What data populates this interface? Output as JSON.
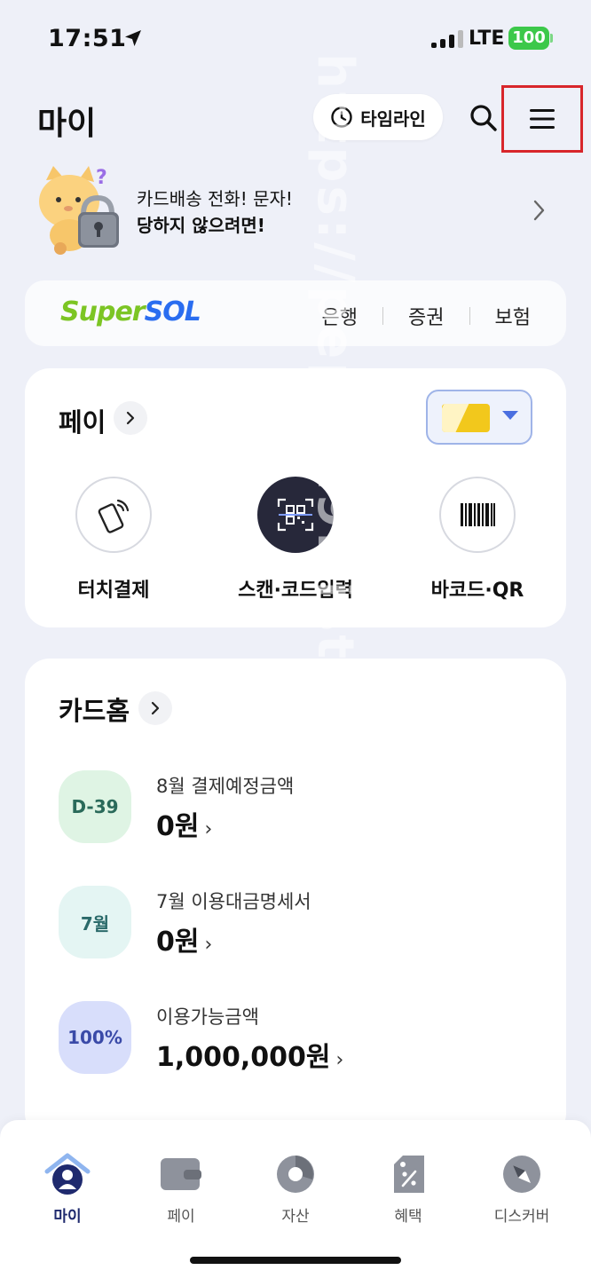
{
  "status_bar": {
    "time": "17:51",
    "network": "LTE",
    "battery": "100",
    "icons": [
      "location-arrow-icon",
      "signal-icon",
      "battery-icon"
    ]
  },
  "header": {
    "title": "마이",
    "timeline_label": "타임라인",
    "icons": [
      "clock-icon",
      "search-icon",
      "menu-icon"
    ]
  },
  "banner": {
    "line1": "카드배송 전화! 문자!",
    "line2": "당하지 않으려면!",
    "icons": [
      "cat-lock-illustration",
      "chevron-right-icon"
    ]
  },
  "supersol": {
    "logo_super": "Super",
    "logo_sol": "SOL",
    "links": [
      "은행",
      "증권",
      "보험"
    ]
  },
  "pay": {
    "title": "페이",
    "actions": [
      {
        "label": "터치결제",
        "icon": "touch-pay-icon"
      },
      {
        "label": "스캔·코드입력",
        "icon": "qr-scan-icon"
      },
      {
        "label": "바코드·QR",
        "icon": "barcode-icon"
      }
    ]
  },
  "cardhome": {
    "title": "카드홈",
    "rows": [
      {
        "badge": "D-39",
        "label": "8월 결제예정금액",
        "value": "0원",
        "badge_bg": "#dff4e4",
        "badge_color": "#2a6a5a"
      },
      {
        "badge": "7월",
        "label": "7월 이용대금명세서",
        "value": "0원",
        "badge_bg": "#e4f5f3",
        "badge_color": "#2a6a6a"
      },
      {
        "badge": "100%",
        "label": "이용가능금액",
        "value": "1,000,000원",
        "badge_bg": "#d8defb",
        "badge_color": "#3a4aa8"
      }
    ]
  },
  "tabbar": {
    "tabs": [
      {
        "label": "마이",
        "icon": "home-person-icon",
        "active": true
      },
      {
        "label": "페이",
        "icon": "wallet-icon",
        "active": false
      },
      {
        "label": "자산",
        "icon": "pie-chart-icon",
        "active": false
      },
      {
        "label": "혜택",
        "icon": "discount-tag-icon",
        "active": false
      },
      {
        "label": "디스커버",
        "icon": "compass-icon",
        "active": false
      }
    ]
  },
  "watermark": "https://pepsi19.tistory.com/",
  "colors": {
    "background": "#eef0f8",
    "highlight_box": "#d8262b",
    "battery": "#3cc84a",
    "accent_navy": "#1f2a6e"
  }
}
